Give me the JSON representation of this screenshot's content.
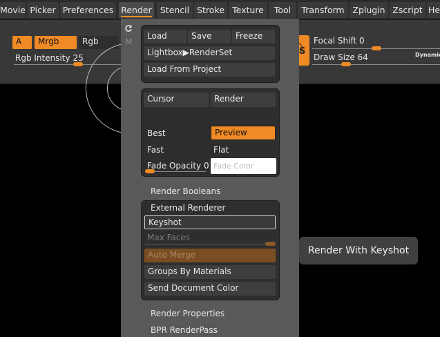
{
  "menubar": {
    "items": [
      "Movie",
      "Picker",
      "Preferences",
      "Render",
      "Stencil",
      "Stroke",
      "Texture",
      "Tool",
      "Transform",
      "Zplugin",
      "Zscript",
      "He"
    ],
    "active": "Render"
  },
  "toolbar": {
    "a_label": "A",
    "mrgb_label": "Mrgb",
    "rgb_label": "Rgb",
    "m_label": "M",
    "rgb_intensity_label": "Rgb Intensity",
    "rgb_intensity_value": "25",
    "s_label": "S",
    "focal_shift_label": "Focal Shift",
    "focal_shift_value": "0",
    "draw_size_label": "Draw Size",
    "draw_size_value": "64",
    "dynamic_label": "Dynamic"
  },
  "render_menu": {
    "load": "Load",
    "save": "Save",
    "freeze": "Freeze",
    "lightbox": "Lightbox▶RenderSet",
    "load_from_project": "Load From Project",
    "cursor": "Cursor",
    "render": "Render",
    "best": "Best",
    "preview": "Preview",
    "fast": "Fast",
    "flat": "Flat",
    "fade_opacity_label": "Fade Opacity",
    "fade_opacity_value": "0",
    "fade_color": "Fade Color",
    "render_booleans": "Render Booleans",
    "external_renderer": "External Renderer",
    "keyshot": "Keyshot",
    "max_faces": "Max Faces",
    "auto_merge": "Auto Merge",
    "groups_by_materials": "Groups By Materials",
    "send_document_color": "Send Document Color",
    "render_properties": "Render Properties",
    "bpr_renderpass": "BPR RenderPass"
  },
  "tooltip": {
    "text": "Render With Keyshot"
  },
  "colors": {
    "accent": "#f08a24",
    "panel": "#595959",
    "group": "#2e2e2e"
  }
}
